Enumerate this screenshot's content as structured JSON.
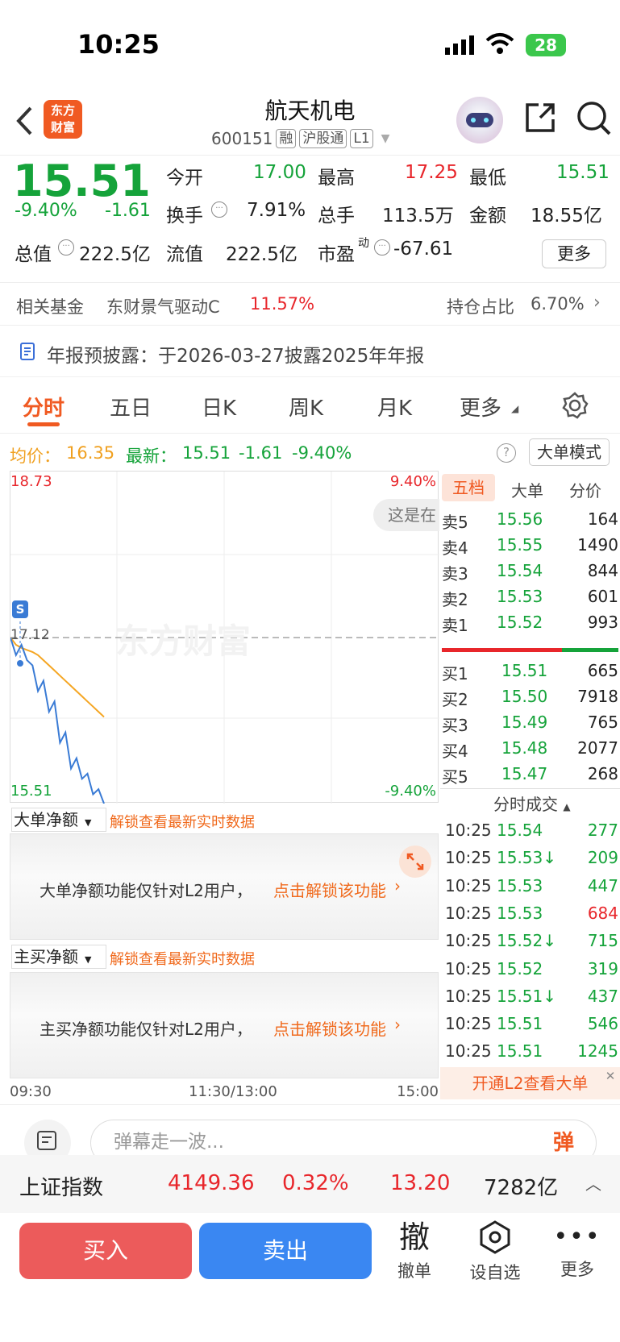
{
  "status": {
    "time": "10:25",
    "battery": "28"
  },
  "header": {
    "logo_line1": "东方",
    "logo_line2": "财富",
    "title": "航天机电",
    "code": "600151",
    "tags": [
      "融",
      "沪股通",
      "L1"
    ]
  },
  "quote": {
    "price": "15.51",
    "pct": "-9.40%",
    "chg": "-1.61",
    "open_label": "今开",
    "open": "17.00",
    "high_label": "最高",
    "high": "17.25",
    "low_label": "最低",
    "low": "15.51",
    "turnover_label": "换手",
    "turnover": "7.91%",
    "volume_label": "总手",
    "volume": "113.5万",
    "amount_label": "金额",
    "amount": "18.55亿",
    "mcap_label": "总值",
    "mcap": "222.5亿",
    "float_label": "流值",
    "float": "222.5亿",
    "pe_label": "市盈",
    "pe_sup": "动",
    "pe": "-67.61",
    "more": "更多"
  },
  "funds": {
    "label": "相关基金",
    "name": "东财景气驱动C",
    "pct": "11.57%",
    "hold_label": "持仓占比",
    "hold": "6.70%"
  },
  "notice": {
    "text": "年报预披露：于2026-03-27披露2025年年报"
  },
  "tabs": [
    "分时",
    "五日",
    "日K",
    "周K",
    "月K",
    "更多"
  ],
  "info": {
    "avg_label": "均价：",
    "avg": "16.35",
    "latest_label": "最新：",
    "latest": "15.51",
    "chg": "-1.61",
    "pct": "-9.40%",
    "mode_btn": "大单模式"
  },
  "chart_data": {
    "type": "line",
    "ylim": [
      15.51,
      18.73
    ],
    "prev_close": "17.12",
    "ymax_label": "18.73",
    "ymin_label": "15.51",
    "pct_top": "9.40%",
    "pct_bottom": "-9.40%",
    "x_labels": [
      "09:30",
      "11:30/13:00",
      "15:00"
    ],
    "tooltip": "这是在",
    "watermark": "东方财富",
    "marker": "S",
    "series": [
      {
        "values": [
          17.12,
          16.95,
          17.05,
          16.9,
          16.85,
          16.6,
          16.7,
          16.4,
          16.5,
          16.1,
          16.2,
          15.85,
          15.95,
          15.75,
          15.8,
          15.6,
          15.65,
          15.51
        ]
      },
      {
        "values": [
          17.12,
          17.05,
          17.02,
          17.0,
          16.98,
          16.95,
          16.9,
          16.85,
          16.8,
          16.75,
          16.7,
          16.65,
          16.6,
          16.55,
          16.5,
          16.45,
          16.4,
          16.35
        ]
      }
    ]
  },
  "orderbook": {
    "tabs": [
      "五档",
      "大单",
      "分价"
    ],
    "asks": [
      {
        "label": "卖5",
        "price": "15.56",
        "vol": "164"
      },
      {
        "label": "卖4",
        "price": "15.55",
        "vol": "1490"
      },
      {
        "label": "卖3",
        "price": "15.54",
        "vol": "844"
      },
      {
        "label": "卖2",
        "price": "15.53",
        "vol": "601"
      },
      {
        "label": "卖1",
        "price": "15.52",
        "vol": "993"
      }
    ],
    "bids": [
      {
        "label": "买1",
        "price": "15.51",
        "vol": "665"
      },
      {
        "label": "买2",
        "price": "15.50",
        "vol": "7918"
      },
      {
        "label": "买3",
        "price": "15.49",
        "vol": "765"
      },
      {
        "label": "买4",
        "price": "15.48",
        "vol": "2077"
      },
      {
        "label": "买5",
        "price": "15.47",
        "vol": "268"
      }
    ],
    "ticks_title": "分时成交",
    "ticks": [
      {
        "t": "10:25",
        "p": "15.54",
        "v": "277",
        "c": "green"
      },
      {
        "t": "10:25",
        "p": "15.53↓",
        "v": "209",
        "c": "green"
      },
      {
        "t": "10:25",
        "p": "15.53",
        "v": "447",
        "c": "green"
      },
      {
        "t": "10:25",
        "p": "15.53",
        "v": "684",
        "c": "red"
      },
      {
        "t": "10:25",
        "p": "15.52↓",
        "v": "715",
        "c": "green"
      },
      {
        "t": "10:25",
        "p": "15.52",
        "v": "319",
        "c": "green"
      },
      {
        "t": "10:25",
        "p": "15.51↓",
        "v": "437",
        "c": "green"
      },
      {
        "t": "10:25",
        "p": "15.51",
        "v": "546",
        "c": "green"
      },
      {
        "t": "10:25",
        "p": "15.51",
        "v": "1245",
        "c": "green"
      }
    ],
    "l2_banner": "开通L2查看大单"
  },
  "panels": {
    "p1_select": "大单净额",
    "p1_link": "解锁查看最新实时数据",
    "p1_msg": "大单净额功能仅针对L2用户，",
    "p1_unlock": "点击解锁该功能",
    "p2_select": "主买净额",
    "p2_link": "解锁查看最新实时数据",
    "p2_msg": "主买净额功能仅针对L2用户，",
    "p2_unlock": "点击解锁该功能"
  },
  "comment": {
    "placeholder": "弹幕走一波...",
    "btn": "弹"
  },
  "index": {
    "name": "上证指数",
    "value": "4149.36",
    "pct": "0.32%",
    "chg": "13.20",
    "amount": "7282亿"
  },
  "actions": {
    "buy": "买入",
    "sell": "卖出",
    "cancel_icon": "撤",
    "cancel": "撤单",
    "watch": "设自选",
    "more": "更多"
  }
}
